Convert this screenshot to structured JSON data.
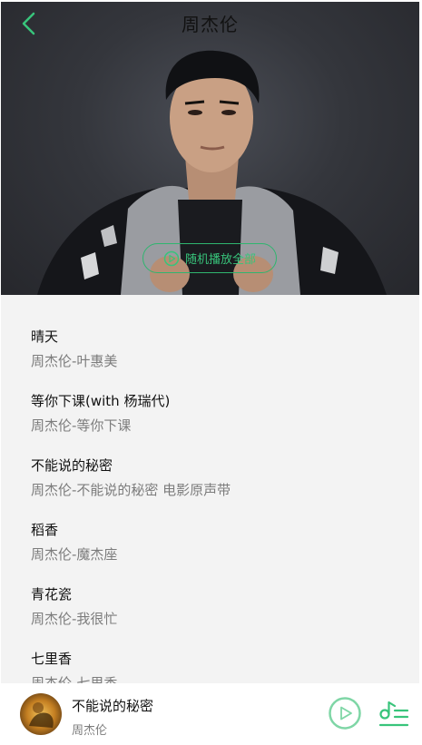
{
  "header": {
    "title": "周杰伦",
    "shuffle_label": "随机播放全部"
  },
  "songs": [
    {
      "name": "晴天",
      "subtitle": "周杰伦-叶惠美"
    },
    {
      "name": "等你下课(with 杨瑞代)",
      "subtitle": "周杰伦-等你下课"
    },
    {
      "name": "不能说的秘密",
      "subtitle": "周杰伦-不能说的秘密 电影原声带"
    },
    {
      "name": "稻香",
      "subtitle": "周杰伦-魔杰座"
    },
    {
      "name": "青花瓷",
      "subtitle": "周杰伦-我很忙"
    },
    {
      "name": "七里香",
      "subtitle": "周杰伦-七里香"
    }
  ],
  "player": {
    "title": "不能说的秘密",
    "artist": "周杰伦"
  },
  "colors": {
    "accent": "#38c47b",
    "background": "#f3f3f3",
    "banner_dark": "#2b2c31"
  },
  "icons": {
    "back": "chevron-left-icon",
    "shuffle": "play-circle-icon",
    "play": "play-circle-icon",
    "playlist": "playlist-icon"
  }
}
